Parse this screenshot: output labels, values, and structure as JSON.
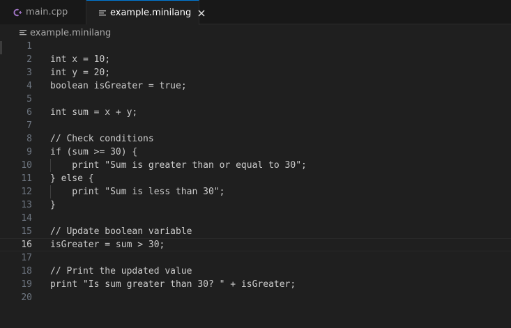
{
  "tabs": [
    {
      "label": "main.cpp",
      "icon": "cpp-icon",
      "active": false
    },
    {
      "label": "example.minilang",
      "icon": "lines-icon",
      "active": true
    }
  ],
  "breadcrumb": {
    "file": "example.minilang"
  },
  "editor": {
    "current_line": 16,
    "lines": [
      {
        "number": "1",
        "text": ""
      },
      {
        "number": "2",
        "text": "int x = 10;"
      },
      {
        "number": "3",
        "text": "int y = 20;"
      },
      {
        "number": "4",
        "text": "boolean isGreater = true;"
      },
      {
        "number": "5",
        "text": ""
      },
      {
        "number": "6",
        "text": "int sum = x + y;"
      },
      {
        "number": "7",
        "text": ""
      },
      {
        "number": "8",
        "text": "// Check conditions"
      },
      {
        "number": "9",
        "text": "if (sum >= 30) {"
      },
      {
        "number": "10",
        "text": "    print \"Sum is greater than or equal to 30\";"
      },
      {
        "number": "11",
        "text": "} else {"
      },
      {
        "number": "12",
        "text": "    print \"Sum is less than 30\";"
      },
      {
        "number": "13",
        "text": "}"
      },
      {
        "number": "14",
        "text": ""
      },
      {
        "number": "15",
        "text": "// Update boolean variable"
      },
      {
        "number": "16",
        "text": "isGreater = sum > 30;"
      },
      {
        "number": "17",
        "text": ""
      },
      {
        "number": "18",
        "text": "// Print the updated value"
      },
      {
        "number": "19",
        "text": "print \"Is sum greater than 30? \" + isGreater;"
      },
      {
        "number": "20",
        "text": ""
      }
    ]
  },
  "colors": {
    "background": "#1f1f1f",
    "tab_bar": "#181818",
    "active_tab_accent": "#0078d4",
    "cpp_icon": "#a074c4",
    "text": "#cccccc",
    "line_number": "#6e7681"
  }
}
